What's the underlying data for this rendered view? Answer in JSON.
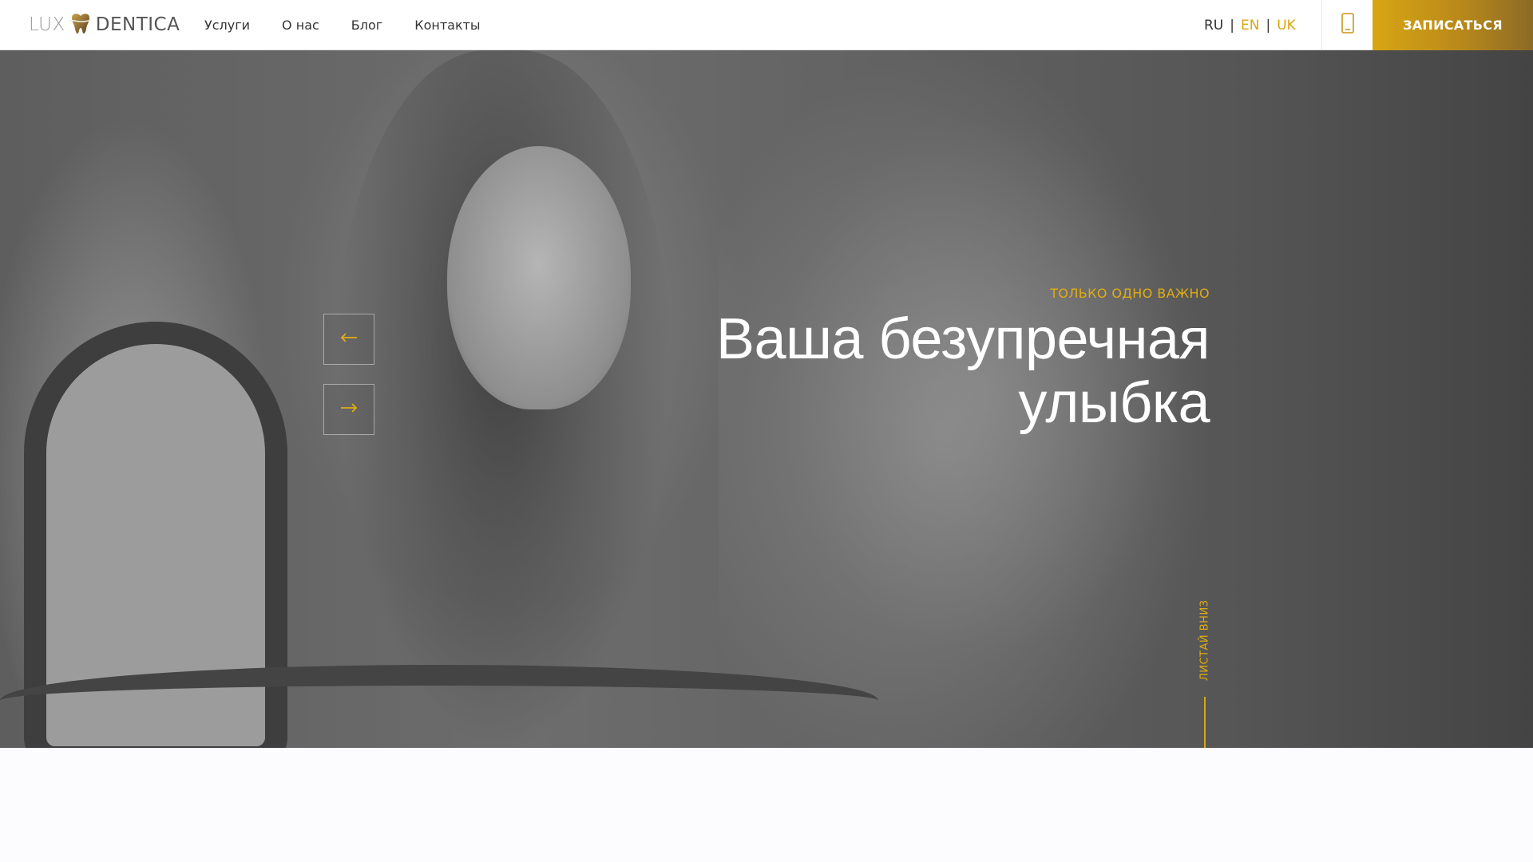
{
  "header": {
    "logo": {
      "part1": "LUX",
      "part2": "DENTICA"
    },
    "nav": [
      {
        "label": "Услуги"
      },
      {
        "label": "О нас"
      },
      {
        "label": "Блог"
      },
      {
        "label": "Контакты"
      }
    ],
    "languages": [
      {
        "label": "RU",
        "active": true
      },
      {
        "label": "EN",
        "active": false
      },
      {
        "label": "UK",
        "active": false
      }
    ],
    "lang_separator": "|",
    "phone_icon": "mobile-phone-icon",
    "cta_label": "ЗАПИСАТЬСЯ"
  },
  "hero": {
    "eyebrow": "ТОЛЬКО ОДНО ВАЖНО",
    "title_line1": "Ваша безупречная",
    "title_line2": "улыбка",
    "prev_icon": "arrow-left-icon",
    "next_icon": "arrow-right-icon",
    "scroll_label": "ЛИСТАЙ ВНИЗ"
  },
  "colors": {
    "accent": "#d9a614",
    "cta_gradient_end": "#8c6a26",
    "hero_overlay": "#5e5e5e",
    "page_background": "#fcfcfe"
  }
}
